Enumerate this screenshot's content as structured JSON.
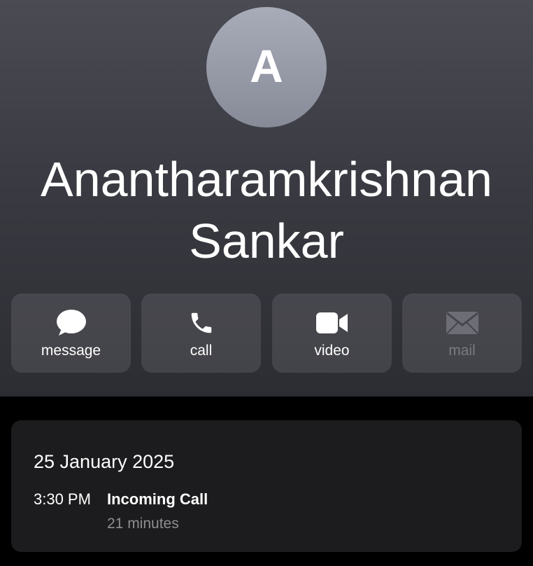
{
  "contact": {
    "initial": "A",
    "name_line1": "Anantharamkrishnan",
    "name_line2": "Sankar"
  },
  "actions": [
    {
      "label": "message",
      "icon": "message-icon",
      "enabled": true
    },
    {
      "label": "call",
      "icon": "phone-icon",
      "enabled": true
    },
    {
      "label": "video",
      "icon": "video-camera-icon",
      "enabled": true
    },
    {
      "label": "mail",
      "icon": "mail-icon",
      "enabled": false
    }
  ],
  "call_log": {
    "date": "25 January 2025",
    "time": "3:30 PM",
    "type": "Incoming Call",
    "duration": "21 minutes"
  },
  "colors": {
    "avatar": "#9a9eab",
    "card": "#1c1c1e",
    "muted_text": "#8e8e93",
    "disabled_text": "#7a7b82"
  }
}
